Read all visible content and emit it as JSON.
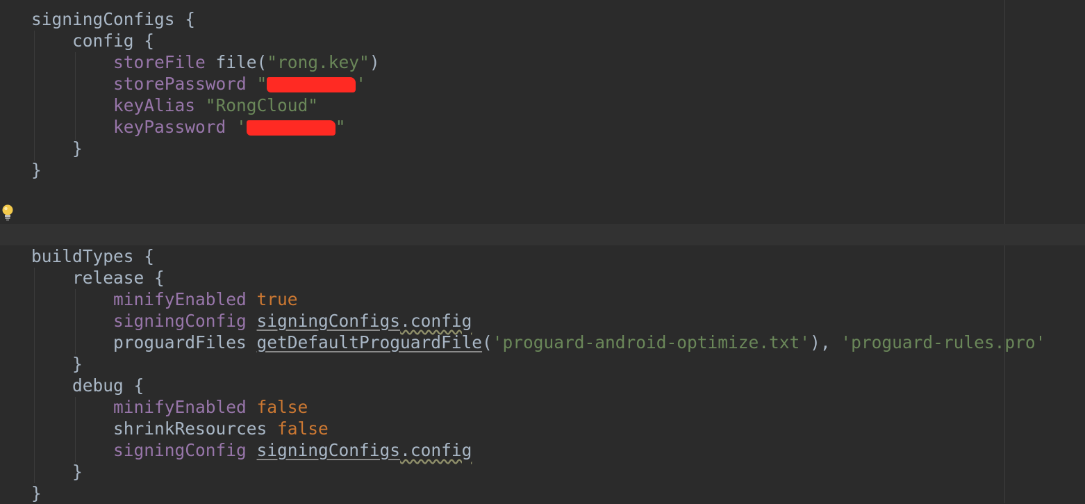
{
  "editor": {
    "colors": {
      "background": "#2b2b2b",
      "keyword": "#cc7832",
      "string": "#6a8759",
      "property": "#9876aa",
      "identifier": "#a9b7c6",
      "redaction": "#ff2a23"
    },
    "gutter_icon": "lightbulb-icon",
    "lines": [
      {
        "segs": [
          {
            "t": "signingConfigs {",
            "c": "id"
          }
        ]
      },
      {
        "segs": [
          {
            "t": "    config {",
            "c": "id"
          }
        ]
      },
      {
        "segs": [
          {
            "t": "        ",
            "c": "id"
          },
          {
            "t": "storeFile",
            "c": "prop"
          },
          {
            "t": " file(",
            "c": "id"
          },
          {
            "t": "\"rong.key\"",
            "c": "str"
          },
          {
            "t": ")",
            "c": "id"
          }
        ]
      },
      {
        "segs": [
          {
            "t": "        ",
            "c": "id"
          },
          {
            "t": "storePassword",
            "c": "prop"
          },
          {
            "t": " \"",
            "c": "str"
          },
          {
            "t": "",
            "c": "redact",
            "w": 128
          },
          {
            "t": "'",
            "c": "str"
          }
        ]
      },
      {
        "segs": [
          {
            "t": "        ",
            "c": "id"
          },
          {
            "t": "keyAlias",
            "c": "prop"
          },
          {
            "t": " \"RongCloud\"",
            "c": "str"
          }
        ]
      },
      {
        "segs": [
          {
            "t": "        ",
            "c": "id"
          },
          {
            "t": "keyPassword",
            "c": "prop"
          },
          {
            "t": " '",
            "c": "str"
          },
          {
            "t": "",
            "c": "redact",
            "w": 128
          },
          {
            "t": "\"",
            "c": "str"
          }
        ]
      },
      {
        "segs": [
          {
            "t": "    }",
            "c": "id"
          }
        ]
      },
      {
        "segs": [
          {
            "t": "}",
            "c": "id"
          }
        ]
      },
      {
        "segs": []
      },
      {
        "segs": []
      },
      {
        "segs": []
      },
      {
        "segs": [
          {
            "t": "buildTypes {",
            "c": "id"
          }
        ]
      },
      {
        "segs": [
          {
            "t": "    release {",
            "c": "id"
          }
        ]
      },
      {
        "segs": [
          {
            "t": "        ",
            "c": "id"
          },
          {
            "t": "minifyEnabled",
            "c": "prop"
          },
          {
            "t": " true",
            "c": "kw"
          }
        ]
      },
      {
        "segs": [
          {
            "t": "        ",
            "c": "id"
          },
          {
            "t": "signingConfig",
            "c": "prop"
          },
          {
            "t": " ",
            "c": "id"
          },
          {
            "t": "signingConfigs",
            "c": "ref"
          },
          {
            "t": ".config",
            "c": "warn"
          }
        ]
      },
      {
        "segs": [
          {
            "t": "        proguardFiles ",
            "c": "id"
          },
          {
            "t": "getDefaultProguardFile",
            "c": "fn"
          },
          {
            "t": "(",
            "c": "id"
          },
          {
            "t": "'proguard-android-optimize.txt'",
            "c": "str"
          },
          {
            "t": "), ",
            "c": "id"
          },
          {
            "t": "'proguard-rules.pro'",
            "c": "str"
          }
        ]
      },
      {
        "segs": [
          {
            "t": "    }",
            "c": "id"
          }
        ]
      },
      {
        "segs": [
          {
            "t": "    debug {",
            "c": "id"
          }
        ]
      },
      {
        "segs": [
          {
            "t": "        ",
            "c": "id"
          },
          {
            "t": "minifyEnabled",
            "c": "prop"
          },
          {
            "t": " false",
            "c": "kw"
          }
        ]
      },
      {
        "segs": [
          {
            "t": "        shrinkResources",
            "c": "id"
          },
          {
            "t": " false",
            "c": "kw"
          }
        ]
      },
      {
        "segs": [
          {
            "t": "        ",
            "c": "id"
          },
          {
            "t": "signingConfig",
            "c": "prop"
          },
          {
            "t": " ",
            "c": "id"
          },
          {
            "t": "signingConfigs",
            "c": "ref"
          },
          {
            "t": ".config",
            "c": "warn"
          }
        ]
      },
      {
        "segs": [
          {
            "t": "    }",
            "c": "id"
          }
        ]
      },
      {
        "segs": [
          {
            "t": "}",
            "c": "id"
          }
        ]
      }
    ]
  }
}
